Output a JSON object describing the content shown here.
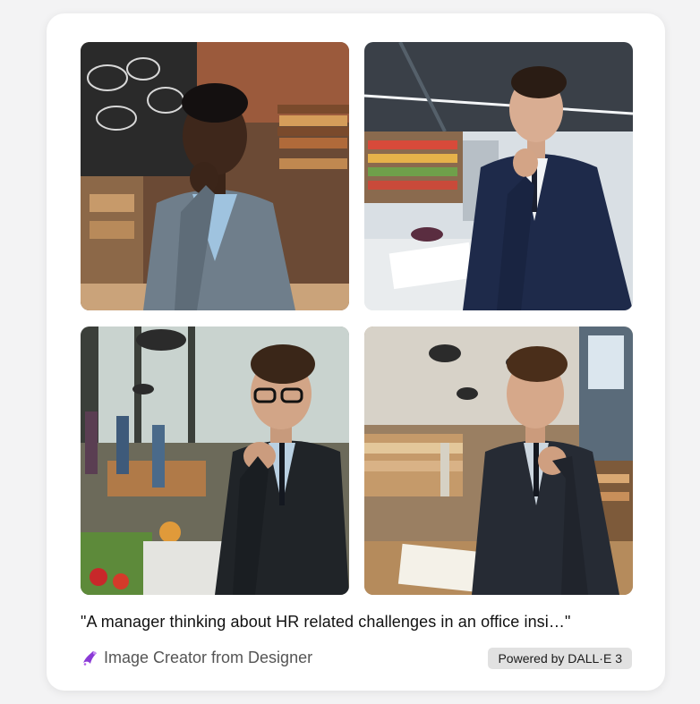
{
  "caption": "\"A manager thinking about HR related challenges in an office insi…\"",
  "footer": {
    "brand_label": "Image Creator from Designer",
    "brand_icon": "designer-sparkle-icon",
    "badge_label": "Powered by DALL·E 3"
  },
  "images": [
    {
      "subject": "manager-photo-1"
    },
    {
      "subject": "manager-photo-2"
    },
    {
      "subject": "manager-photo-3"
    },
    {
      "subject": "manager-photo-4"
    }
  ],
  "colors": {
    "page_bg": "#f3f3f4",
    "card_bg": "#ffffff",
    "badge_bg": "#e1e1e1",
    "brand_icon": "#8a3ad6"
  }
}
